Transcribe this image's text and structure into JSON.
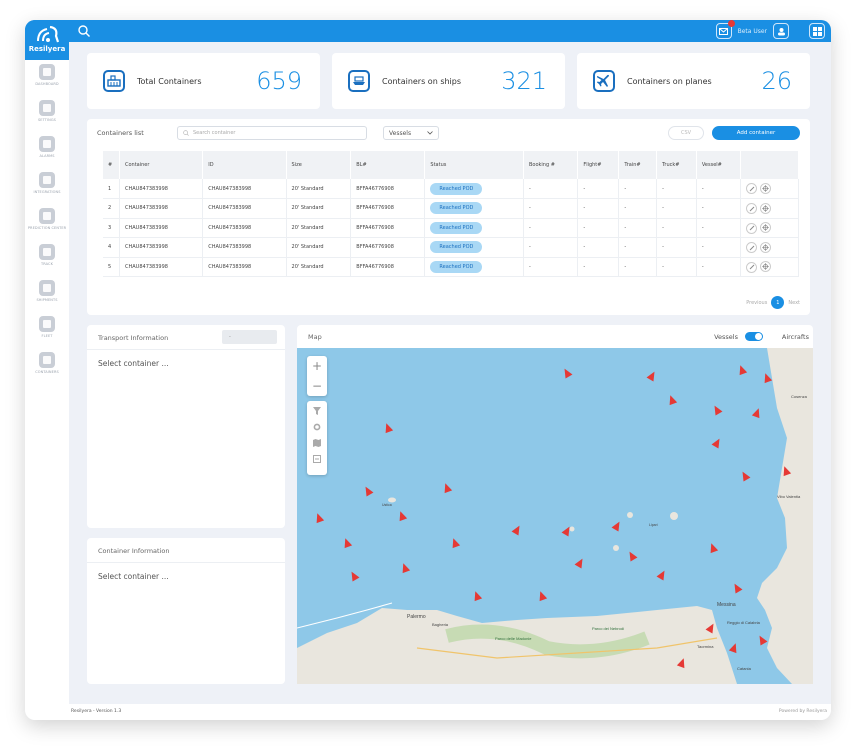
{
  "brand": {
    "name": "Resilyera",
    "color": "#1a8fe3"
  },
  "topbar": {
    "user_name": "Beta User"
  },
  "sidebar": {
    "items": [
      {
        "label": "DASHBOARD",
        "icon": "dashboard-icon"
      },
      {
        "label": "SETTINGS",
        "icon": "settings-icon"
      },
      {
        "label": "ALARMS",
        "icon": "alarms-icon"
      },
      {
        "label": "INTEGRATIONS",
        "icon": "integrations-icon"
      },
      {
        "label": "PREDICTION CENTER",
        "icon": "prediction-icon"
      },
      {
        "label": "TRACK",
        "icon": "track-icon"
      },
      {
        "label": "SHIPMENTS",
        "icon": "shipments-icon"
      },
      {
        "label": "FLEET",
        "icon": "fleet-icon"
      },
      {
        "label": "CONTAINERS",
        "icon": "containers-icon"
      }
    ]
  },
  "stats": [
    {
      "label": "Total Containers",
      "value": "659",
      "icon": "containers-stat-icon"
    },
    {
      "label": "Containers on ships",
      "value": "321",
      "icon": "ship-icon"
    },
    {
      "label": "Containers on planes",
      "value": "26",
      "icon": "plane-icon"
    }
  ],
  "containers_list": {
    "title": "Containers list",
    "search_placeholder": "Search container",
    "filter_value": "Vessels",
    "csv_label": "CSV",
    "add_label": "Add container",
    "columns": [
      "#",
      "Container",
      "ID",
      "Size",
      "BL#",
      "Status",
      "Booking #",
      "Flight#",
      "Train#",
      "Truck#",
      "Vessel#"
    ],
    "rows": [
      [
        "1",
        "CHAU847383998",
        "CHAU847383998",
        "20' Standard",
        "BFFA46776908",
        "Reached POD",
        "-",
        "-",
        "-",
        "-",
        "-"
      ],
      [
        "2",
        "CHAU847383998",
        "CHAU847383998",
        "20' Standard",
        "BFFA46776908",
        "Reached POD",
        "-",
        "-",
        "-",
        "-",
        "-"
      ],
      [
        "3",
        "CHAU847383998",
        "CHAU847383998",
        "20' Standard",
        "BFFA46776908",
        "Reached POD",
        "-",
        "-",
        "-",
        "-",
        "-"
      ],
      [
        "4",
        "CHAU847383998",
        "CHAU847383998",
        "20' Standard",
        "BFFA46776908",
        "Reached POD",
        "-",
        "-",
        "-",
        "-",
        "-"
      ],
      [
        "5",
        "CHAU847383998",
        "CHAU847383998",
        "20' Standard",
        "BFFA46776908",
        "Reached POD",
        "-",
        "-",
        "-",
        "-",
        "-"
      ]
    ],
    "pager": {
      "previous": "Previous",
      "current": "1",
      "next": "Next"
    }
  },
  "transport_info": {
    "title": "Transport Information",
    "select_value": "-",
    "placeholder": "Select container ..."
  },
  "container_info": {
    "title": "Container Information",
    "placeholder": "Select container ..."
  },
  "map": {
    "title": "Map",
    "toggle_left": "Vessels",
    "toggle_right": "Aircrafts",
    "places": [
      "Palermo",
      "Bagheria",
      "Messina",
      "Reggio di Calabria",
      "Cosenza",
      "Vibo Valentia",
      "Parco dei Nebrodi",
      "Parco delle Madonie",
      "Catania",
      "Taormina",
      "Lipari",
      "Ustica"
    ],
    "sea_color": "#8ec8e8",
    "land_color": "#e9e6de",
    "marker_color": "#e53935"
  },
  "footer": {
    "version": "Resilyera - Version 1.3",
    "powered": "Powered by Resilyera"
  }
}
